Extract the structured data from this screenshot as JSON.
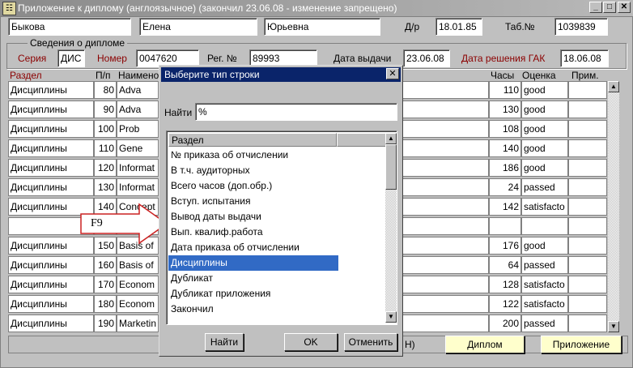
{
  "window": {
    "title": "Приложение к диплому (англоязычное) (закончил 23.06.08 - изменение запрещено)",
    "app_icon": "app-icon"
  },
  "person": {
    "last_name": "Быкова",
    "first_name": "Елена",
    "patronymic": "Юрьевна",
    "dob_label": "Д/р",
    "dob": "18.01.85",
    "tab_label": "Таб.№",
    "tab_no": "1039839"
  },
  "diploma": {
    "group_label": "Сведения о дипломе",
    "series_label": "Серия",
    "series": "ДИС",
    "number_label": "Номер",
    "number": "0047620",
    "reg_label": "Рег. №",
    "reg_no": "89993",
    "issue_label": "Дата выдачи",
    "issue_date": "23.06.08",
    "gak_label": "Дата решения ГАК",
    "gak_date": "18.06.08"
  },
  "table": {
    "headers": {
      "section": "Раздел",
      "pp": "П/п",
      "name": "Наимено",
      "hours": "Часы",
      "grade": "Оценка",
      "note": "Прим."
    },
    "rows": [
      {
        "section": "Дисциплины",
        "pp": "80",
        "name": "Adva",
        "hours": "110",
        "grade": "good"
      },
      {
        "section": "Дисциплины",
        "pp": "90",
        "name": "Adva",
        "hours": "130",
        "grade": "good"
      },
      {
        "section": "Дисциплины",
        "pp": "100",
        "name": "Prob",
        "hours": "108",
        "grade": "good"
      },
      {
        "section": "Дисциплины",
        "pp": "110",
        "name": "Gene",
        "hours": "140",
        "grade": "good"
      },
      {
        "section": "Дисциплины",
        "pp": "120",
        "name": "Informat",
        "hours": "186",
        "grade": "good"
      },
      {
        "section": "Дисциплины",
        "pp": "130",
        "name": "Informat",
        "hours": "24",
        "grade": "passed"
      },
      {
        "section": "Дисциплины",
        "pp": "140",
        "name": "Concept",
        "hours": "142",
        "grade": "satisfacto"
      },
      {
        "section": "",
        "pp": "",
        "name": "",
        "hours": "",
        "grade": ""
      },
      {
        "section": "Дисциплины",
        "pp": "150",
        "name": "Basis of",
        "hours": "176",
        "grade": "good"
      },
      {
        "section": "Дисциплины",
        "pp": "160",
        "name": "Basis of",
        "hours": "64",
        "grade": "passed"
      },
      {
        "section": "Дисциплины",
        "pp": "170",
        "name": "Econom",
        "hours": "128",
        "grade": "satisfacto"
      },
      {
        "section": "Дисциплины",
        "pp": "180",
        "name": "Econom",
        "hours": "122",
        "grade": "satisfacto"
      },
      {
        "section": "Дисциплины",
        "pp": "190",
        "name": "Marketin",
        "hours": "200",
        "grade": "passed"
      }
    ]
  },
  "callout": {
    "text": "F9"
  },
  "bottom": {
    "partial_label": "Н)",
    "diploma_btn": "Диплом",
    "supplement_btn": "Приложение"
  },
  "dialog": {
    "title": "Выберите тип строки",
    "find_label": "Найти",
    "find_value": "%",
    "list_header": "Раздел",
    "items": [
      "№ приказа об отчислении",
      "В т.ч. аудиторных",
      "Всего часов (доп.обр.)",
      "Вступ. испытания",
      "Вывод даты выдачи",
      "Вып. квалиф.работа",
      "Дата приказа об отчислении",
      "Дисциплины",
      "Дубликат",
      "Дубликат приложения",
      "Закончил"
    ],
    "selected_index": 7,
    "btn_find": "Найти",
    "btn_ok": "OK",
    "btn_cancel": "Отменить"
  }
}
